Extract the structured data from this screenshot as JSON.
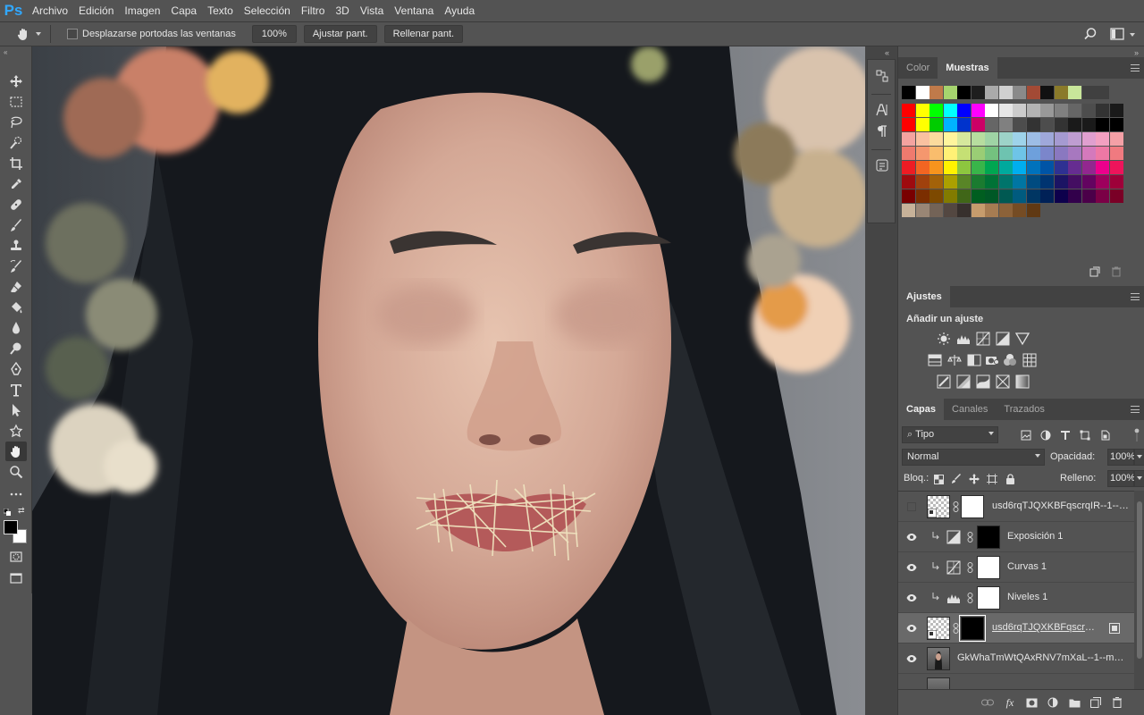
{
  "app": {
    "logo": "Ps"
  },
  "menu": [
    "Archivo",
    "Edición",
    "Imagen",
    "Capa",
    "Texto",
    "Selección",
    "Filtro",
    "3D",
    "Vista",
    "Ventana",
    "Ayuda"
  ],
  "options": {
    "scroll_all_label": "Desplazarse portodas las ventanas",
    "zoom_value": "100%",
    "fit_screen": "Ajustar pant.",
    "fill_screen": "Rellenar pant."
  },
  "color_panel": {
    "tabs": [
      "Color",
      "Muestras"
    ],
    "active_tab": "Muestras"
  },
  "adjustments_panel": {
    "tab": "Ajustes",
    "heading": "Añadir un ajuste"
  },
  "layers_panel": {
    "tabs": [
      "Capas",
      "Canales",
      "Trazados"
    ],
    "filter_kind": "Tipo",
    "blend_mode": "Normal",
    "opacity_label": "Opacidad:",
    "opacity_value": "100%",
    "lock_label": "Bloq.:",
    "fill_label": "Relleno:",
    "fill_value": "100%",
    "layers": [
      {
        "name": "usd6rqTJQXKBFqscrqIR--1--za...",
        "visible": false,
        "type": "smart-with-mask",
        "mask": "white",
        "selected": false
      },
      {
        "name": "Exposición 1",
        "visible": true,
        "type": "adjustment",
        "icon": "exposure-icon",
        "mask": "black",
        "selected": false
      },
      {
        "name": "Curvas 1",
        "visible": true,
        "type": "adjustment",
        "icon": "curves-icon",
        "mask": "white",
        "selected": false
      },
      {
        "name": "Niveles 1",
        "visible": true,
        "type": "adjustment",
        "icon": "levels-icon",
        "mask": "white",
        "selected": false
      },
      {
        "name": "usd6rqTJQXKBFqscrqIR--1...",
        "visible": true,
        "type": "smart-with-mask",
        "mask": "black",
        "selected": true
      },
      {
        "name": "GkWhaTmWtQAxRNV7mXaL--1--mgd7...",
        "visible": true,
        "type": "image",
        "selected": false
      }
    ]
  },
  "colors": {
    "ps_blue": "#31a8ff",
    "panel_bg": "#535353",
    "panel_dark": "#424242",
    "selected_row": "#696969"
  }
}
